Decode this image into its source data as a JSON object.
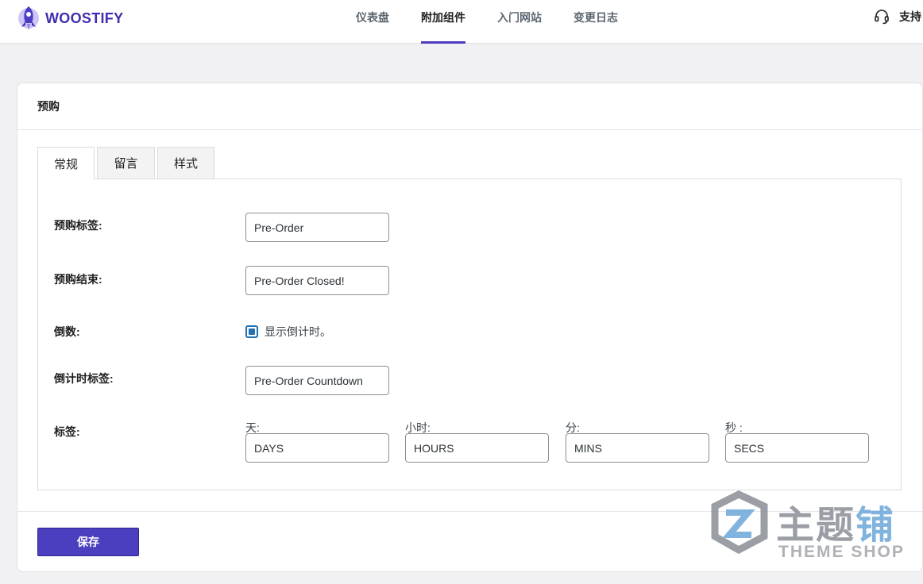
{
  "header": {
    "brand": "WOOSTIFY",
    "nav": [
      {
        "label": "仪表盘",
        "active": false
      },
      {
        "label": "附加组件",
        "active": true
      },
      {
        "label": "入门网站",
        "active": false
      },
      {
        "label": "变更日志",
        "active": false
      }
    ],
    "support_label": "支持"
  },
  "card": {
    "title": "预购",
    "tabs": [
      {
        "label": "常规",
        "active": true
      },
      {
        "label": "留言",
        "active": false
      },
      {
        "label": "样式",
        "active": false
      }
    ],
    "fields": {
      "preorder_label": {
        "label": "预购标签:",
        "value": "Pre-Order"
      },
      "preorder_closed": {
        "label": "预购结束:",
        "value": "Pre-Order Closed!"
      },
      "countdown": {
        "label": "倒数:",
        "checkbox_text": "显示倒计时。",
        "checked": true
      },
      "countdown_label": {
        "label": "倒计时标签:",
        "value": "Pre-Order Countdown"
      },
      "labels": {
        "label": "标签:",
        "days": {
          "sub": "天:",
          "value": "DAYS"
        },
        "hours": {
          "sub": "小时:",
          "value": "HOURS"
        },
        "mins": {
          "sub": "分:",
          "value": "MINS"
        },
        "secs": {
          "sub": "秒 :",
          "value": "SECS"
        }
      }
    },
    "save_label": "保存"
  },
  "watermark": {
    "cn_main": "主题",
    "cn_accent": "铺",
    "en": "THEME SHOP"
  },
  "colors": {
    "brand": "#3f2fb0",
    "accent": "#4b3fbf",
    "checkbox": "#2271b1"
  }
}
